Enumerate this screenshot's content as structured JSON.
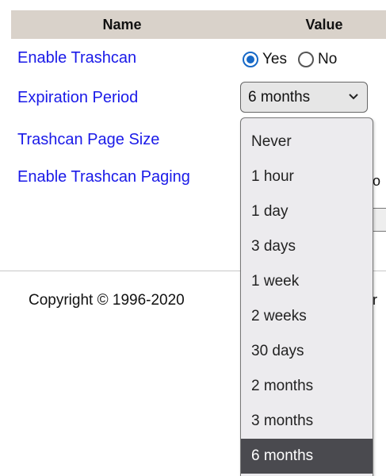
{
  "table": {
    "header_name": "Name",
    "header_value": "Value"
  },
  "settings": {
    "enable_trashcan": {
      "label": "Enable Trashcan",
      "options": [
        {
          "label": "Yes",
          "checked": true
        },
        {
          "label": "No",
          "checked": false
        }
      ]
    },
    "expiration_period": {
      "label": "Expiration Period",
      "selected": "6 months",
      "options": [
        "Never",
        "1 hour",
        "1 day",
        "3 days",
        "1 week",
        "2 weeks",
        "30 days",
        "2 months",
        "3 months",
        "6 months"
      ],
      "highlighted": "6 months"
    },
    "trashcan_page_size": {
      "label": "Trashcan Page Size"
    },
    "enable_trashcan_paging": {
      "label": "Enable Trashcan Paging"
    }
  },
  "footer": {
    "copyright": "Copyright © 1996-2020"
  },
  "colors": {
    "label_blue": "#1a1ae8",
    "header_bg": "#d9d2ca",
    "radio_blue": "#1769c7",
    "selected_bg": "#4a4a4f"
  },
  "icons": {
    "chevron": "chevron-down-icon"
  }
}
